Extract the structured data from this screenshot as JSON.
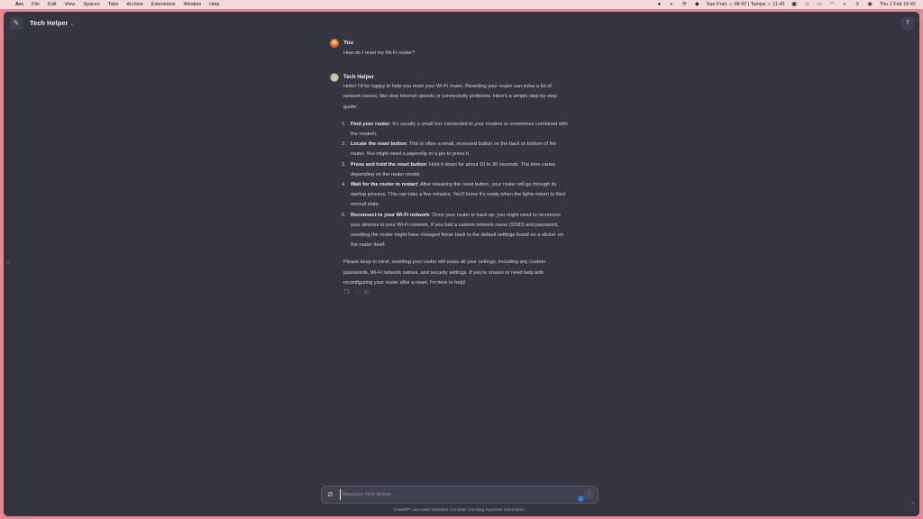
{
  "menubar": {
    "apple": "",
    "items": [
      "Arc",
      "File",
      "Edit",
      "View",
      "Spaces",
      "Tabs",
      "Archive",
      "Extensions",
      "Window",
      "Help"
    ],
    "clock_text": "San Fran ☼ 08:42 | Tampa ☼ 11:42",
    "datetime": "Thu 1 Feb  16:42"
  },
  "header": {
    "title": "Tech Helper",
    "new_chat_icon": "✎",
    "share_icon": "⇪"
  },
  "conversation": {
    "user": {
      "name": "You",
      "text": "How do I reset my Wi-Fi router?"
    },
    "assistant": {
      "name": "Tech Helper",
      "intro": "Hello! I'd be happy to help you reset your Wi-Fi router. Resetting your router can solve a lot of network issues, like slow internet speeds or connectivity problems. Here's a simple step-by-step guide:",
      "steps": [
        {
          "title": "Find your router",
          "text": ": It's usually a small box connected to your modem or sometimes combined with the modem."
        },
        {
          "title": "Locate the reset button",
          "text": ": This is often a small, recessed button on the back or bottom of the router. You might need a paperclip or a pin to press it."
        },
        {
          "title": "Press and hold the reset button",
          "text": ": Hold it down for about 10 to 30 seconds. The time varies depending on the router model."
        },
        {
          "title": "Wait for the router to restart",
          "text": ": After releasing the reset button, your router will go through its startup process. This can take a few minutes. You'll know it's ready when the lights return to their normal state."
        },
        {
          "title": "Reconnect to your Wi-Fi network",
          "text": ": Once your router is back up, you might need to reconnect your devices to your Wi-Fi network. If you had a custom network name (SSID) and password, resetting the router might have changed these back to the default settings found on a sticker on the router itself."
        }
      ],
      "closing": "Please keep in mind, resetting your router will erase all your settings, including any custom passwords, Wi-Fi network names, and security settings. If you're unsure or need help with reconfiguring your router after a reset, I'm here to help!"
    }
  },
  "composer": {
    "placeholder": "Message Tech Helper…",
    "disclaimer": "ChatGPT can make mistakes. Consider checking important information."
  },
  "help_label": "?"
}
